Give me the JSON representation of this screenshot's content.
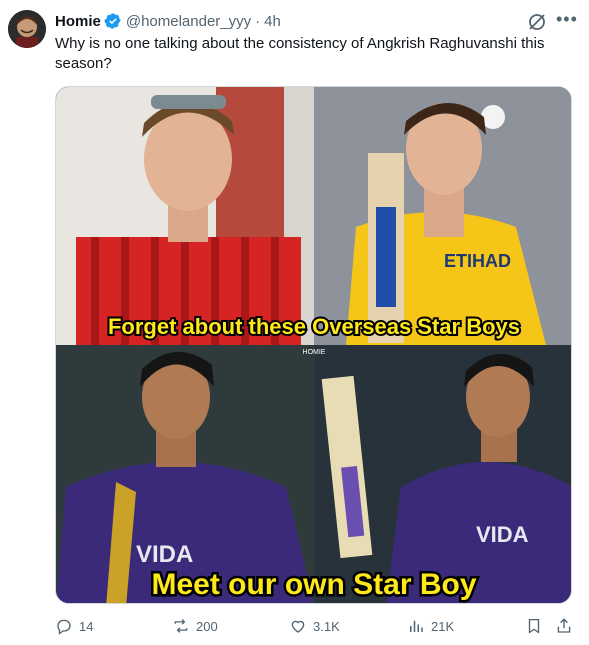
{
  "tweet": {
    "author_name": "Homie",
    "author_handle": "@homelander_yyy",
    "separator": "·",
    "time": "4h",
    "text": "Why is no one talking about the consistency of Angkrish Raghuvanshi this season?"
  },
  "media": {
    "caption_top": "Forget about these Overseas Star Boys",
    "caption_bottom": "Meet our own Star Boy",
    "watermark": "HOMIE",
    "jersey_text": "VIDA"
  },
  "actions": {
    "replies": "14",
    "reposts": "200",
    "likes": "3.1K",
    "views": "21K"
  },
  "colors": {
    "verified": "#1d9bf0",
    "caption_fill": "#ffe81a",
    "kkr_purple": "#3b2a7a",
    "csk_yellow": "#f5c518",
    "red_shirt": "#d62424"
  },
  "icons": [
    "verified-icon",
    "grok-icon",
    "more-icon",
    "reply-icon",
    "repost-icon",
    "like-icon",
    "views-icon",
    "bookmark-icon",
    "share-icon"
  ]
}
